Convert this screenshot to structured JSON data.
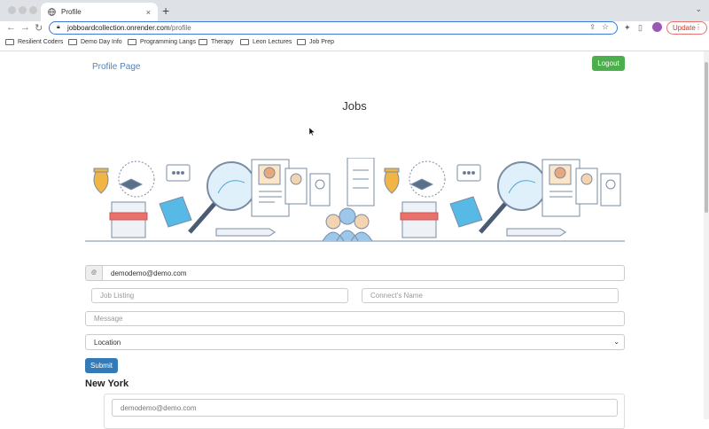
{
  "browser": {
    "tab_title": "Profile",
    "tab_close": "×",
    "new_tab": "+",
    "url_host": "jobboardcollection.onrender.com",
    "url_path": "/profile",
    "update_label": "Update",
    "bookmarks": [
      {
        "label": "Resilient Coders"
      },
      {
        "label": "Demo Day Info"
      },
      {
        "label": "Programming Langs"
      },
      {
        "label": "Therapy"
      },
      {
        "label": "Leon Lectures"
      },
      {
        "label": "Job Prep"
      }
    ]
  },
  "navbar": {
    "brand": "Profile Page",
    "logout_label": "Logout"
  },
  "main": {
    "title": "Jobs",
    "email_addon_icon": "at-sign-icon",
    "email_value": "demodemo@demo.com",
    "job_listing_placeholder": "Job Listing",
    "connect_name_placeholder": "Connect's Name",
    "message_placeholder": "Message",
    "location_selected": "Location",
    "submit_label": "Submit",
    "location_heading": "New York",
    "card_email": "demodemo@demo.com"
  },
  "colors": {
    "brand_link": "#4a86c5",
    "logout_bg": "#4cae4c",
    "submit_bg": "#337ab7",
    "omnibox_border": "#3a7bd5"
  }
}
